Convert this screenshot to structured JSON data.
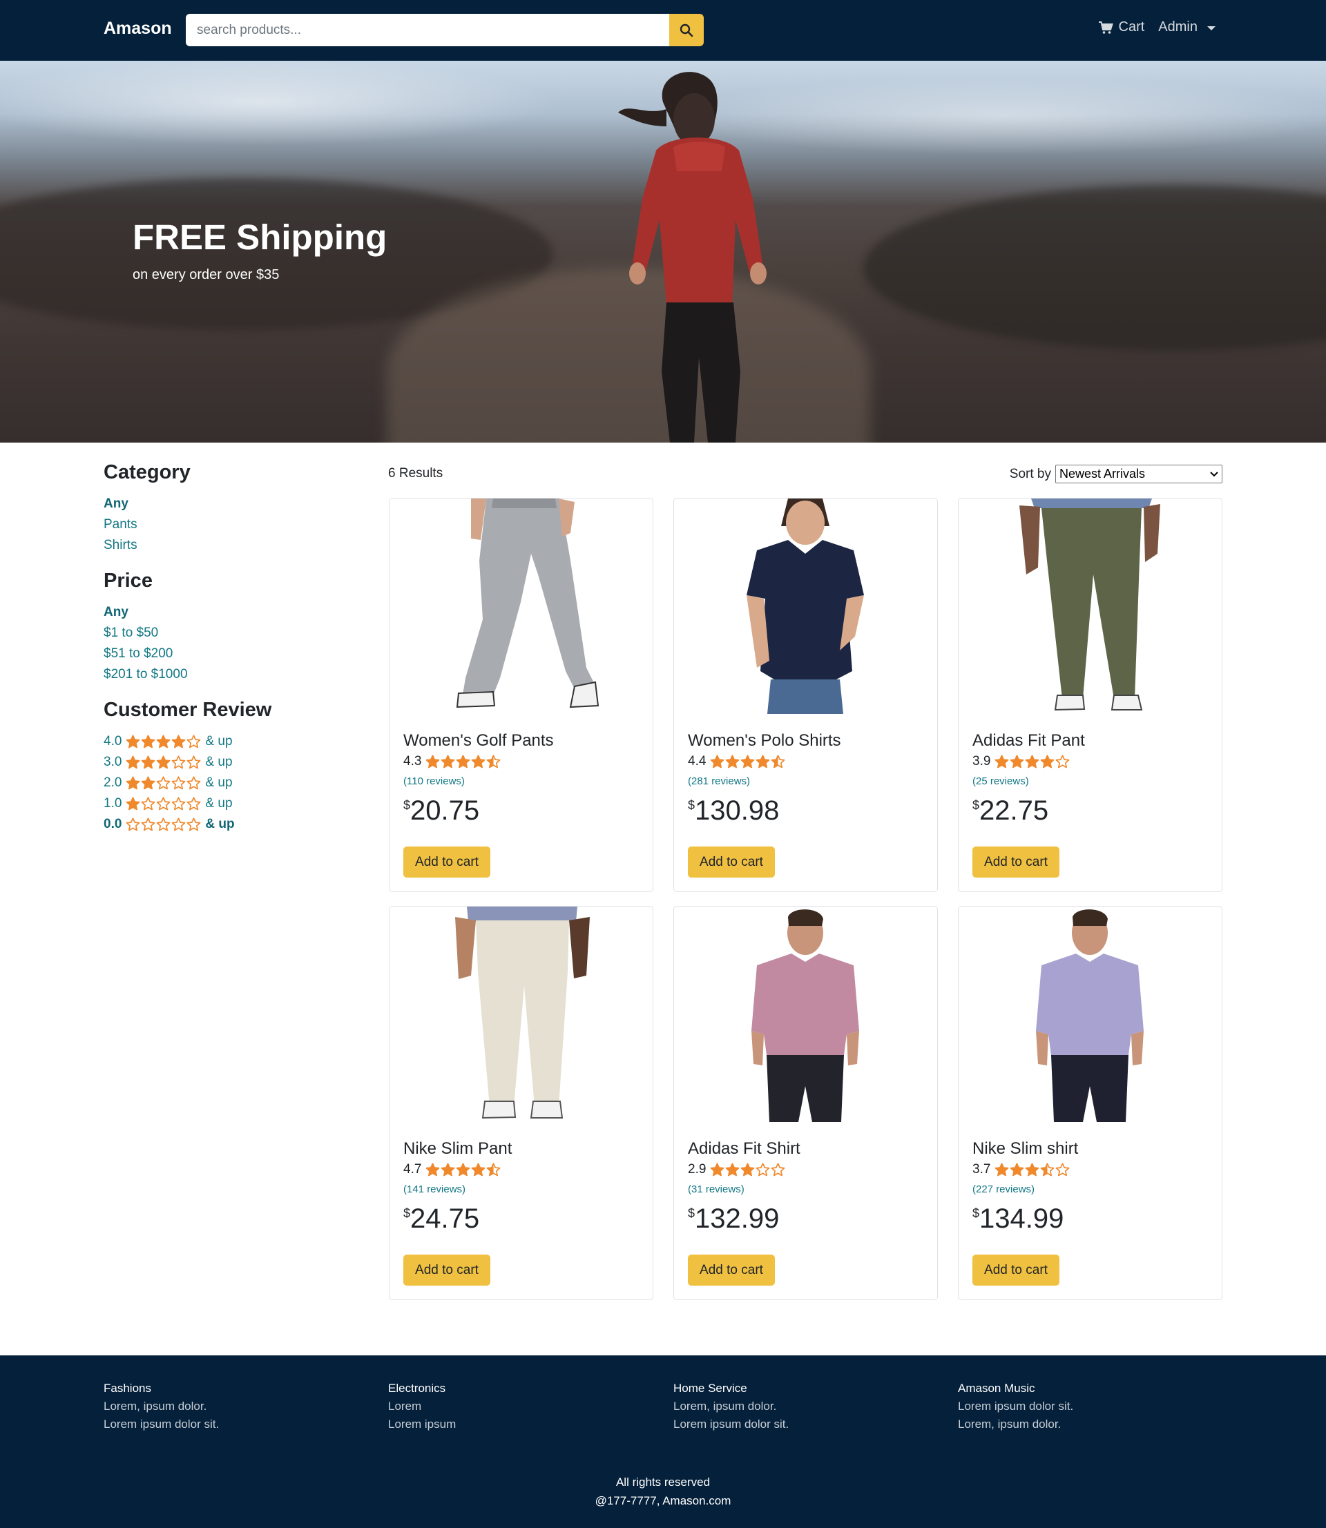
{
  "navbar": {
    "brand": "Amason",
    "search_placeholder": "search products...",
    "cart_label": "Cart",
    "admin_label": "Admin"
  },
  "hero": {
    "title": "FREE Shipping",
    "subtitle": "on every order over $35"
  },
  "sidebar": {
    "category_heading": "Category",
    "categories": [
      "Any",
      "Pants",
      "Shirts"
    ],
    "price_heading": "Price",
    "prices": [
      "Any",
      "$1 to $50",
      "$51 to $200",
      "$201 to $1000"
    ],
    "review_heading": "Customer Review",
    "reviews": [
      {
        "value": "4.0",
        "stars": 4,
        "suffix": "& up"
      },
      {
        "value": "3.0",
        "stars": 3,
        "suffix": "& up"
      },
      {
        "value": "2.0",
        "stars": 2,
        "suffix": "& up"
      },
      {
        "value": "1.0",
        "stars": 1,
        "suffix": "& up"
      },
      {
        "value": "0.0",
        "stars": 0,
        "suffix": "& up"
      }
    ]
  },
  "results": {
    "count_label": "6 Results",
    "sort_label": "Sort by",
    "sort_value": "Newest Arrivals"
  },
  "products": [
    {
      "name": "Women's Golf Pants",
      "rating": "4.3",
      "stars": 4.3,
      "reviews": "(110 reviews)",
      "currency": "$",
      "price": "20.75",
      "button": "Add to cart"
    },
    {
      "name": "Women's Polo Shirts",
      "rating": "4.4",
      "stars": 4.4,
      "reviews": "(281 reviews)",
      "currency": "$",
      "price": "130.98",
      "button": "Add to cart"
    },
    {
      "name": "Adidas Fit Pant",
      "rating": "3.9",
      "stars": 3.9,
      "reviews": "(25 reviews)",
      "currency": "$",
      "price": "22.75",
      "button": "Add to cart"
    },
    {
      "name": "Nike Slim Pant",
      "rating": "4.7",
      "stars": 4.7,
      "reviews": "(141 reviews)",
      "currency": "$",
      "price": "24.75",
      "button": "Add to cart"
    },
    {
      "name": "Adidas Fit Shirt",
      "rating": "2.9",
      "stars": 2.9,
      "reviews": "(31 reviews)",
      "currency": "$",
      "price": "132.99",
      "button": "Add to cart"
    },
    {
      "name": "Nike Slim shirt",
      "rating": "3.7",
      "stars": 3.7,
      "reviews": "(227 reviews)",
      "currency": "$",
      "price": "134.99",
      "button": "Add to cart"
    }
  ],
  "footer": {
    "columns": [
      {
        "heading": "Fashions",
        "lines": [
          "Lorem, ipsum dolor.",
          "Lorem ipsum dolor sit."
        ]
      },
      {
        "heading": "Electronics",
        "lines": [
          "Lorem",
          "Lorem ipsum"
        ]
      },
      {
        "heading": "Home Service",
        "lines": [
          "Lorem, ipsum dolor.",
          "Lorem ipsum dolor sit."
        ]
      },
      {
        "heading": "Amason Music",
        "lines": [
          "Lorem ipsum dolor sit.",
          "Lorem, ipsum dolor."
        ]
      }
    ],
    "rights": "All rights reserved",
    "contact": "@177-7777, Amason.com"
  },
  "colors": {
    "navbar": "#05203a",
    "accent": "#f0c040",
    "link": "#127784",
    "star": "#f0882c"
  }
}
